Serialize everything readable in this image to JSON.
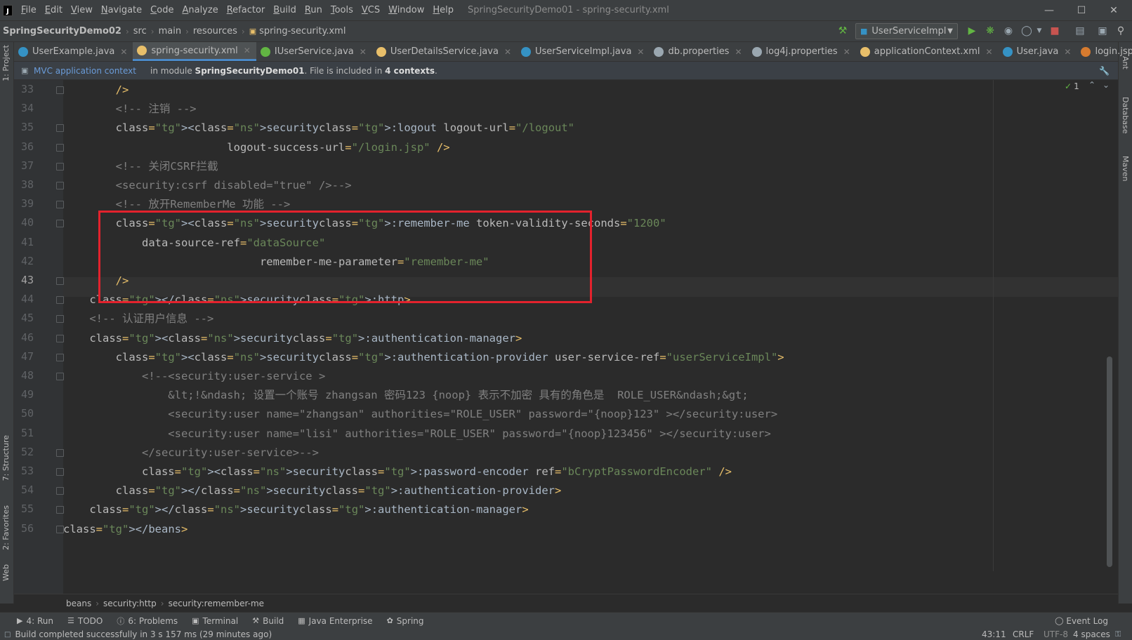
{
  "menu": {
    "items": [
      "File",
      "Edit",
      "View",
      "Navigate",
      "Code",
      "Analyze",
      "Refactor",
      "Build",
      "Run",
      "Tools",
      "VCS",
      "Window",
      "Help"
    ],
    "window_title": "SpringSecurityDemo01 - spring-security.xml"
  },
  "nav": {
    "project": "SpringSecurityDemo02",
    "crumbs": [
      "src",
      "main",
      "resources",
      "spring-security.xml"
    ],
    "run_config": "UserServiceImpl"
  },
  "tabs": [
    {
      "label": "UserExample.java",
      "icon": "class-icon",
      "color": "#3592c4"
    },
    {
      "label": "spring-security.xml",
      "icon": "xml-icon",
      "color": "#e8bf6a",
      "active": true
    },
    {
      "label": "IUserService.java",
      "icon": "interface-icon",
      "color": "#62b543"
    },
    {
      "label": "UserDetailsService.java",
      "icon": "xml-icon",
      "color": "#e8bf6a"
    },
    {
      "label": "UserServiceImpl.java",
      "icon": "class-icon",
      "color": "#3592c4"
    },
    {
      "label": "db.properties",
      "icon": "properties-icon",
      "color": "#9aa7b0"
    },
    {
      "label": "log4j.properties",
      "icon": "properties-icon",
      "color": "#9aa7b0"
    },
    {
      "label": "applicationContext.xml",
      "icon": "xml-icon",
      "color": "#e8bf6a"
    },
    {
      "label": "User.java",
      "icon": "class-icon",
      "color": "#3592c4"
    },
    {
      "label": "login.jsp",
      "icon": "jsp-icon",
      "color": "#d67b2f"
    }
  ],
  "banner": {
    "link": "MVC application context",
    "prefix": "in module ",
    "module": "SpringSecurityDemo01",
    "middle": ". File is included in ",
    "count": "4 contexts",
    "suffix": "."
  },
  "inspection": {
    "ok_count": "1"
  },
  "side_labels": {
    "left": [
      "1: Project",
      "7: Structure",
      "2: Favorites",
      "Web"
    ],
    "right": [
      "Ant",
      "Database",
      "Maven"
    ]
  },
  "code": {
    "current_line": "43",
    "lines": [
      {
        "n": "33",
        "t": "        />"
      },
      {
        "n": "34",
        "t": "        <!-- 注销 -->"
      },
      {
        "n": "35",
        "t": "        <security:logout logout-url=\"/logout\""
      },
      {
        "n": "36",
        "t": "                         logout-success-url=\"/login.jsp\" />"
      },
      {
        "n": "37",
        "t": "        <!-- 关闭CSRF拦截"
      },
      {
        "n": "38",
        "t": "        <security:csrf disabled=\"true\" />-->"
      },
      {
        "n": "39",
        "t": "        <!-- 放开RememberMe 功能 -->"
      },
      {
        "n": "40",
        "t": "        <security:remember-me token-validity-seconds=\"1200\""
      },
      {
        "n": "41",
        "t": "            data-source-ref=\"dataSource\""
      },
      {
        "n": "42",
        "t": "                              remember-me-parameter=\"remember-me\""
      },
      {
        "n": "43",
        "t": "        />"
      },
      {
        "n": "44",
        "t": "    </security:http>"
      },
      {
        "n": "45",
        "t": "    <!-- 认证用户信息 -->"
      },
      {
        "n": "46",
        "t": "    <security:authentication-manager>"
      },
      {
        "n": "47",
        "t": "        <security:authentication-provider user-service-ref=\"userServiceImpl\">"
      },
      {
        "n": "48",
        "t": "            <!--<security:user-service >"
      },
      {
        "n": "49",
        "t": "                &lt;!&ndash; 设置一个账号 zhangsan 密码123 {noop} 表示不加密 具有的角色是  ROLE_USER&ndash;&gt;"
      },
      {
        "n": "50",
        "t": "                <security:user name=\"zhangsan\" authorities=\"ROLE_USER\" password=\"{noop}123\" ></security:user>"
      },
      {
        "n": "51",
        "t": "                <security:user name=\"lisi\" authorities=\"ROLE_USER\" password=\"{noop}123456\" ></security:user>"
      },
      {
        "n": "52",
        "t": "            </security:user-service>-->"
      },
      {
        "n": "53",
        "t": "            <security:password-encoder ref=\"bCryptPasswordEncoder\" />"
      },
      {
        "n": "54",
        "t": "        </security:authentication-provider>"
      },
      {
        "n": "55",
        "t": "    </security:authentication-manager>"
      },
      {
        "n": "56",
        "t": "</beans>"
      }
    ]
  },
  "breadcrumb_bottom": [
    "beans",
    "security:http",
    "security:remember-me"
  ],
  "tool_windows": [
    {
      "label": "4: Run",
      "icon": "run-icon"
    },
    {
      "label": "TODO",
      "icon": "list-icon"
    },
    {
      "label": "6: Problems",
      "icon": "problems-icon"
    },
    {
      "label": "Terminal",
      "icon": "terminal-icon"
    },
    {
      "label": "Build",
      "icon": "hammer-icon"
    },
    {
      "label": "Java Enterprise",
      "icon": "enterprise-icon"
    },
    {
      "label": "Spring",
      "icon": "spring-icon"
    }
  ],
  "event_log": "Event Log",
  "status": {
    "message": "Build completed successfully in 3 s 157 ms (29 minutes ago)",
    "position": "43:11",
    "line_sep": "CRLF",
    "encoding": "UTF-8",
    "indent": "4 spaces"
  },
  "colors": {
    "highlight_box": "#e3222d",
    "accent": "#4a88c7"
  }
}
